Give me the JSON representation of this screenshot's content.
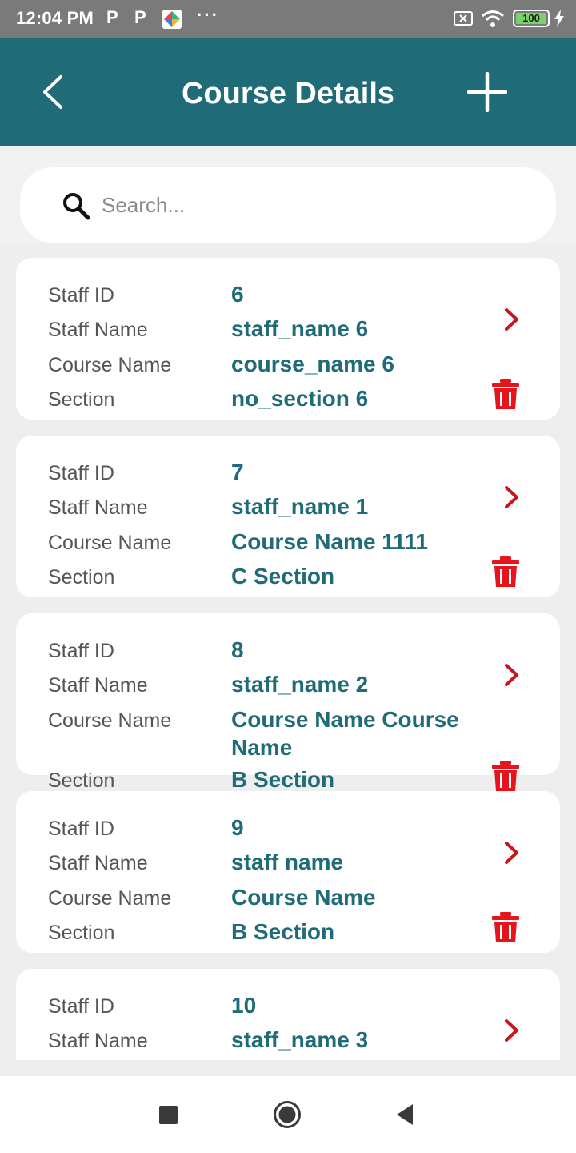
{
  "status_bar": {
    "time": "12:04 PM",
    "notif_1": "P",
    "notif_2": "P",
    "more": "···",
    "battery": "100",
    "icons": [
      "app-icon",
      "sim-x-icon",
      "wifi-icon",
      "battery-icon",
      "charging-icon"
    ]
  },
  "header": {
    "title": "Course Details",
    "back_icon": "chevron-left-icon",
    "add_icon": "plus-icon",
    "color": "#1f6b78"
  },
  "search": {
    "placeholder": "Search...",
    "icon": "search-icon"
  },
  "labels": {
    "staff_id": "Staff ID",
    "staff_name": "Staff Name",
    "course_name": "Course Name",
    "section": "Section"
  },
  "courses": [
    {
      "staff_id": "6",
      "staff_name": "staff_name 6",
      "course_name": "course_name 6",
      "section": "no_section 6"
    },
    {
      "staff_id": "7",
      "staff_name": "staff_name 1",
      "course_name": "Course Name 1111",
      "section": "C Section"
    },
    {
      "staff_id": "8",
      "staff_name": "staff_name 2",
      "course_name": "Course Name Course Name",
      "section": "B Section"
    },
    {
      "staff_id": "9",
      "staff_name": "staff name",
      "course_name": "Course Name",
      "section": "B Section"
    },
    {
      "staff_id": "10",
      "staff_name": "staff_name 3"
    }
  ],
  "colors": {
    "accent": "#1f6b78",
    "delete": "#e8141c",
    "chevron": "#c8161d"
  }
}
